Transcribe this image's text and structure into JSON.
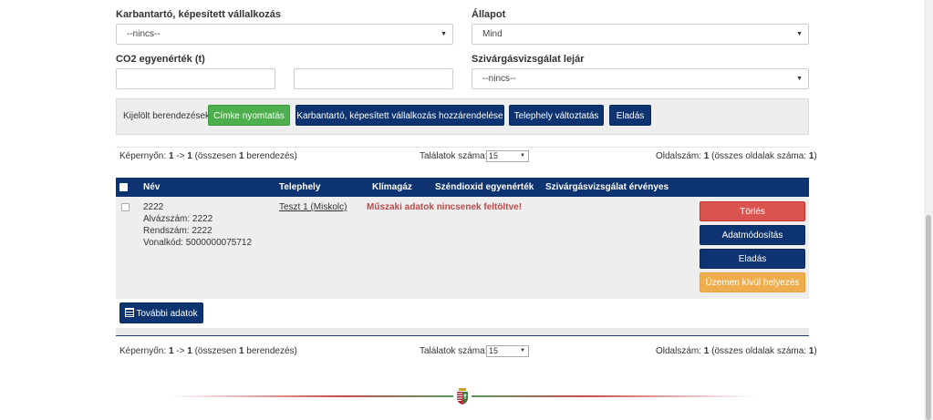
{
  "filters": {
    "contractor_label": "Karbantartó, képesített vállalkozás",
    "contractor_value": "--nincs--",
    "status_label": "Állapot",
    "status_value": "Mind",
    "co2_label": "CO2 egyenérték (t)",
    "co2_from": "",
    "co2_to": "",
    "leak_label": "Szivárgásvizsgálat lejár",
    "leak_value": "--nincs--"
  },
  "bulk": {
    "label": "Kijelölt berendezések:",
    "print_label": "Címke nyomtatás",
    "assign_label": "Karbantartó, képesített vállalkozás hozzárendelése",
    "site_change_label": "Telephely változtatás",
    "sell_label": "Eladás"
  },
  "pager_top": {
    "prefix": "Képernyőn:",
    "from": "1",
    "arrow": "->",
    "to": "1",
    "total_open": "(összesen",
    "total": "1",
    "total_close": "berendezés)",
    "results_label": "Találatok száma:",
    "per_page": "15",
    "page_label": "Oldalszám:",
    "page": "1",
    "pages_open": "(összes oldalak száma:",
    "pages": "1",
    "pages_close": ")"
  },
  "pager_bottom": {
    "prefix": "Képernyőn:",
    "from": "1",
    "arrow": "->",
    "to": "1",
    "total_open": "(összesen",
    "total": "1",
    "total_close": "berendezés)",
    "results_label": "Találatok száma:",
    "per_page": "15",
    "page_label": "Oldalszám:",
    "page": "1",
    "pages_open": "(összes oldalak száma:",
    "pages": "1",
    "pages_close": ")"
  },
  "table": {
    "headers": [
      "Név",
      "Telephely",
      "Klímagáz",
      "Széndioxid egyenérték",
      "Szivárgásvizsgálat érvényes"
    ],
    "row": {
      "name": "2222",
      "chassis": "Alvázszám: 2222",
      "order": "Rendszám: 2222",
      "barcode": "Vonalkód: 5000000075712",
      "site": "Teszt 1 (Miskolc)",
      "warning": "Műszaki adatok nincsenek feltöltve!",
      "actions": {
        "delete": "Törlés",
        "edit": "Adatmódosítás",
        "sell": "Eladás",
        "decommission": "Üzemen kívül helyezés"
      }
    }
  },
  "more_data_label": "További adatok",
  "colors": {
    "navy": "#0d3470",
    "green": "#4cae4c",
    "red": "#d9534f",
    "orange": "#f0ad4e",
    "warning_text": "#b94a48"
  },
  "icons": {
    "more_data": "list-icon",
    "crest": "hungarian-coat-of-arms-icon"
  }
}
